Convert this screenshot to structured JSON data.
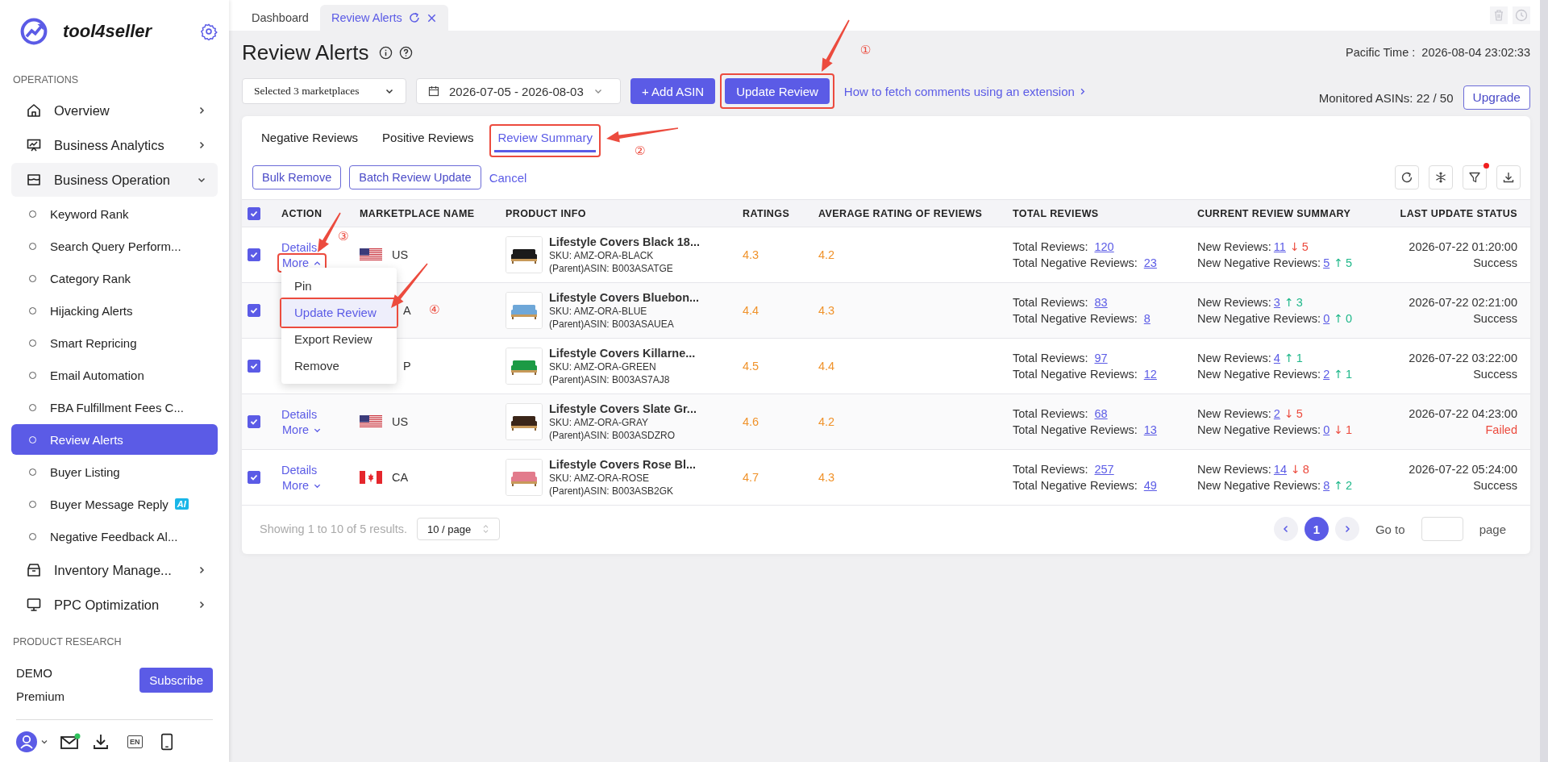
{
  "sidebar": {
    "brand": "tool4seller",
    "section": "OPERATIONS",
    "items": [
      {
        "label": "Overview",
        "expanded": false
      },
      {
        "label": "Business Analytics",
        "expanded": false
      },
      {
        "label": "Business Operation",
        "expanded": true,
        "children": [
          {
            "label": "Keyword Rank",
            "selected": false
          },
          {
            "label": "Search Query Perform...",
            "selected": false
          },
          {
            "label": "Category Rank",
            "selected": false
          },
          {
            "label": "Hijacking Alerts",
            "selected": false
          },
          {
            "label": "Smart Repricing",
            "selected": false
          },
          {
            "label": "Email Automation",
            "selected": false
          },
          {
            "label": "FBA Fulfillment Fees C...",
            "selected": false
          },
          {
            "label": "Review Alerts",
            "selected": true
          },
          {
            "label": "Buyer Listing",
            "selected": false
          },
          {
            "label": "Buyer Message Reply",
            "selected": false,
            "badge": "AI"
          },
          {
            "label": "Negative Feedback Al...",
            "selected": false
          }
        ]
      },
      {
        "label": "Inventory Manage...",
        "expanded": false
      },
      {
        "label": "PPC Optimization",
        "expanded": false
      }
    ],
    "next_section": "PRODUCT RESEARCH",
    "account": {
      "name": "DEMO",
      "plan": "Premium",
      "button": "Subscribe"
    },
    "language": "EN",
    "mail_unread": true
  },
  "tabs": [
    {
      "label": "Dashboard",
      "selected": false
    },
    {
      "label": "Review Alerts",
      "selected": true
    }
  ],
  "header": {
    "title": "Review Alerts",
    "time_label": "Pacific Time :",
    "time": "2026-08-04 23:02:33",
    "marketplaces": "Selected 3 marketplaces",
    "date_range": "2026-07-05 - 2026-08-03",
    "add_button": "+ Add ASIN",
    "update_button": {
      "label": "Update Review",
      "highlighted": true,
      "callout": "①"
    },
    "help_link": "How to fetch comments using an extension",
    "monitored": "Monitored ASINs: 22 / 50",
    "upgrade": "Upgrade"
  },
  "view_tabs": [
    {
      "label": "Negative Reviews",
      "selected": false
    },
    {
      "label": "Positive Reviews",
      "selected": false
    },
    {
      "label": "Review Summary",
      "selected": true,
      "highlighted": true,
      "callout": "②"
    }
  ],
  "bulk": {
    "buttons": [
      "Bulk Remove",
      "Batch Review Update"
    ],
    "cancel": "Cancel",
    "filter_active": true
  },
  "table": {
    "all_checked": true,
    "columns": [
      "ACTION",
      "MARKETPLACE NAME",
      "PRODUCT INFO",
      "RATINGS",
      "AVERAGE RATING OF REVIEWS",
      "TOTAL REVIEWS",
      "CURRENT REVIEW SUMMARY",
      "LAST UPDATE STATUS"
    ],
    "rows": [
      {
        "checked": true,
        "actions": {
          "details": "Details",
          "more": "More",
          "expanded": true,
          "highlighted": true,
          "callout": "③"
        },
        "flag": {
          "kind": "us"
        },
        "marketplace": "US",
        "product": "Lifestyle Covers Black 18...",
        "sku": "SKU: AMZ-ORA-BLACK",
        "asin": "(Parent)ASIN: B003ASATGE",
        "rating": "4.3",
        "avg_rating": "4.2",
        "total": {
          "label": "Total Reviews:",
          "value": "120"
        },
        "total_negative": {
          "label": "Total Negative Reviews:",
          "value": "23"
        },
        "new": {
          "label": "New Reviews:",
          "value": "11",
          "trend": "↓",
          "rising": false,
          "change": "5"
        },
        "new_negative": {
          "label": "New Negative Reviews:",
          "value": "5",
          "trend": "↑",
          "rising": true,
          "change": "5"
        },
        "updated": "2026-07-22 01:20:00",
        "status": "Success",
        "failed": false
      },
      {
        "checked": true,
        "marketplace": "A",
        "product": "Lifestyle Covers Bluebon...",
        "sku": "SKU: AMZ-ORA-BLUE",
        "asin": "(Parent)ASIN: B003ASAUEA",
        "rating": "4.4",
        "avg_rating": "4.3",
        "total": {
          "label": "Total Reviews:",
          "value": "83"
        },
        "total_negative": {
          "label": "Total Negative Reviews:",
          "value": "8"
        },
        "new": {
          "label": "New Reviews:",
          "value": "3",
          "trend": "↑",
          "rising": true,
          "change": "3"
        },
        "new_negative": {
          "label": "New Negative Reviews:",
          "value": "0",
          "trend": "↑",
          "rising": true,
          "change": "0"
        },
        "updated": "2026-07-22 02:21:00",
        "status": "Success",
        "failed": false
      },
      {
        "checked": true,
        "marketplace": "P",
        "product": "Lifestyle Covers Killarne...",
        "sku": "SKU: AMZ-ORA-GREEN",
        "asin": "(Parent)ASIN: B003AS7AJ8",
        "rating": "4.5",
        "avg_rating": "4.4",
        "total": {
          "label": "Total Reviews:",
          "value": "97"
        },
        "total_negative": {
          "label": "Total Negative Reviews:",
          "value": "12"
        },
        "new": {
          "label": "New Reviews:",
          "value": "4",
          "trend": "↑",
          "rising": true,
          "change": "1"
        },
        "new_negative": {
          "label": "New Negative Reviews:",
          "value": "2",
          "trend": "↑",
          "rising": true,
          "change": "1"
        },
        "updated": "2026-07-22 03:22:00",
        "status": "Success",
        "failed": false
      },
      {
        "checked": true,
        "actions": {
          "details": "Details",
          "more": "More",
          "expanded": false,
          "highlighted": false
        },
        "flag": {
          "kind": "us"
        },
        "marketplace": "US",
        "product": "Lifestyle Covers Slate Gr...",
        "sku": "SKU: AMZ-ORA-GRAY",
        "asin": "(Parent)ASIN: B003ASDZRO",
        "rating": "4.6",
        "avg_rating": "4.2",
        "total": {
          "label": "Total Reviews:",
          "value": "68"
        },
        "total_negative": {
          "label": "Total Negative Reviews:",
          "value": "13"
        },
        "new": {
          "label": "New Reviews:",
          "value": "2",
          "trend": "↓",
          "rising": false,
          "change": "5"
        },
        "new_negative": {
          "label": "New Negative Reviews:",
          "value": "0",
          "trend": "↓",
          "rising": false,
          "change": "1"
        },
        "updated": "2026-07-22 04:23:00",
        "status": "Failed",
        "failed": true
      },
      {
        "checked": true,
        "actions": {
          "details": "Details",
          "more": "More",
          "expanded": false,
          "highlighted": false
        },
        "flag": {
          "kind": "ca"
        },
        "marketplace": "CA",
        "product": "Lifestyle Covers Rose Bl...",
        "sku": "SKU: AMZ-ORA-ROSE",
        "asin": "(Parent)ASIN: B003ASB2GK",
        "rating": "4.7",
        "avg_rating": "4.3",
        "total": {
          "label": "Total Reviews:",
          "value": "257"
        },
        "total_negative": {
          "label": "Total Negative Reviews:",
          "value": "49"
        },
        "new": {
          "label": "New Reviews:",
          "value": "14",
          "trend": "↓",
          "rising": false,
          "change": "8"
        },
        "new_negative": {
          "label": "New Negative Reviews:",
          "value": "8",
          "trend": "↑",
          "rising": true,
          "change": "2"
        },
        "updated": "2026-07-22 05:24:00",
        "status": "Success",
        "failed": false
      }
    ]
  },
  "menu": [
    {
      "label": "Pin",
      "selected": false
    },
    {
      "label": "Update Review",
      "selected": true,
      "highlighted": true,
      "callout": "④"
    },
    {
      "label": "Export Review",
      "selected": false
    },
    {
      "label": "Remove",
      "selected": false
    }
  ],
  "footer": {
    "summary": "Showing 1 to 10 of 5 results.",
    "page_size": "10 / page",
    "pages": [
      {
        "label": "1",
        "selected": true
      }
    ],
    "goto": "Go to",
    "page": "page"
  }
}
